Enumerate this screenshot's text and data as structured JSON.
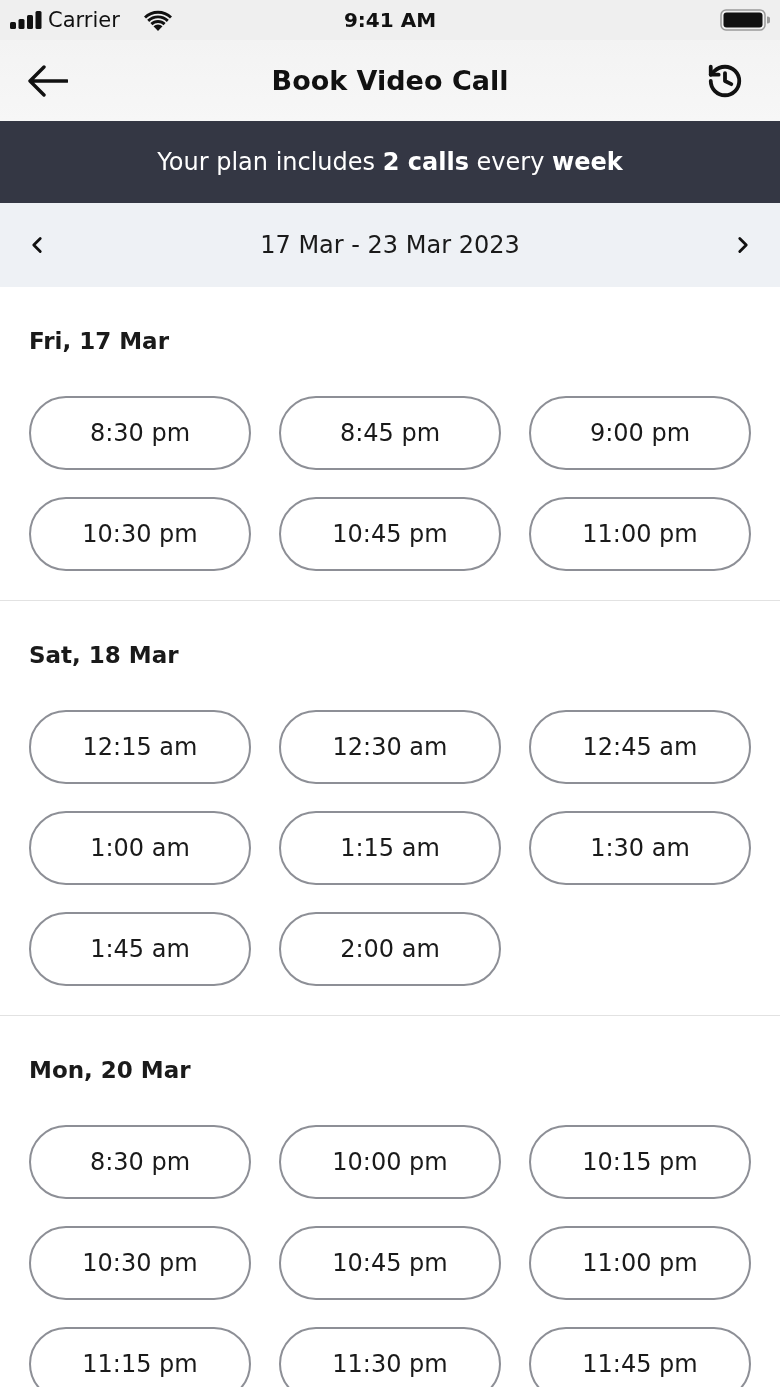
{
  "status_bar": {
    "carrier": "Carrier",
    "time": "9:41 AM"
  },
  "header": {
    "title": "Book Video Call"
  },
  "banner": {
    "text": "Your plan includes **2 calls** every **week**"
  },
  "week_nav": {
    "range": "17 Mar - 23 Mar 2023"
  },
  "days": [
    {
      "label": "Fri, 17 Mar",
      "slots": [
        {
          "time": "8:30 pm",
          "selected": false
        },
        {
          "time": "8:45 pm",
          "selected": false
        },
        {
          "time": "9:00 pm",
          "selected": false
        },
        {
          "time": "10:30 pm",
          "selected": false
        },
        {
          "time": "10:45 pm",
          "selected": false
        },
        {
          "time": "11:00 pm",
          "selected": false
        }
      ]
    },
    {
      "label": "Sat, 18 Mar",
      "slots": [
        {
          "time": "12:15 am",
          "selected": false
        },
        {
          "time": "12:30 am",
          "selected": false
        },
        {
          "time": "12:45 am",
          "selected": false
        },
        {
          "time": "1:00 am",
          "selected": false
        },
        {
          "time": "1:15 am",
          "selected": false
        },
        {
          "time": "1:30 am",
          "selected": false
        },
        {
          "time": "1:45 am",
          "selected": false
        },
        {
          "time": "2:00 am",
          "selected": false
        }
      ]
    },
    {
      "label": "Mon, 20 Mar",
      "slots": [
        {
          "time": "8:30 pm",
          "selected": false
        },
        {
          "time": "10:00 pm",
          "selected": false
        },
        {
          "time": "10:15 pm",
          "selected": false
        },
        {
          "time": "10:30 pm",
          "selected": false
        },
        {
          "time": "10:45 pm",
          "selected": false
        },
        {
          "time": "11:00 pm",
          "selected": false
        },
        {
          "time": "11:15 pm",
          "selected": false
        },
        {
          "time": "11:30 pm",
          "selected": false
        },
        {
          "time": "11:45 pm",
          "selected": false
        }
      ]
    }
  ]
}
